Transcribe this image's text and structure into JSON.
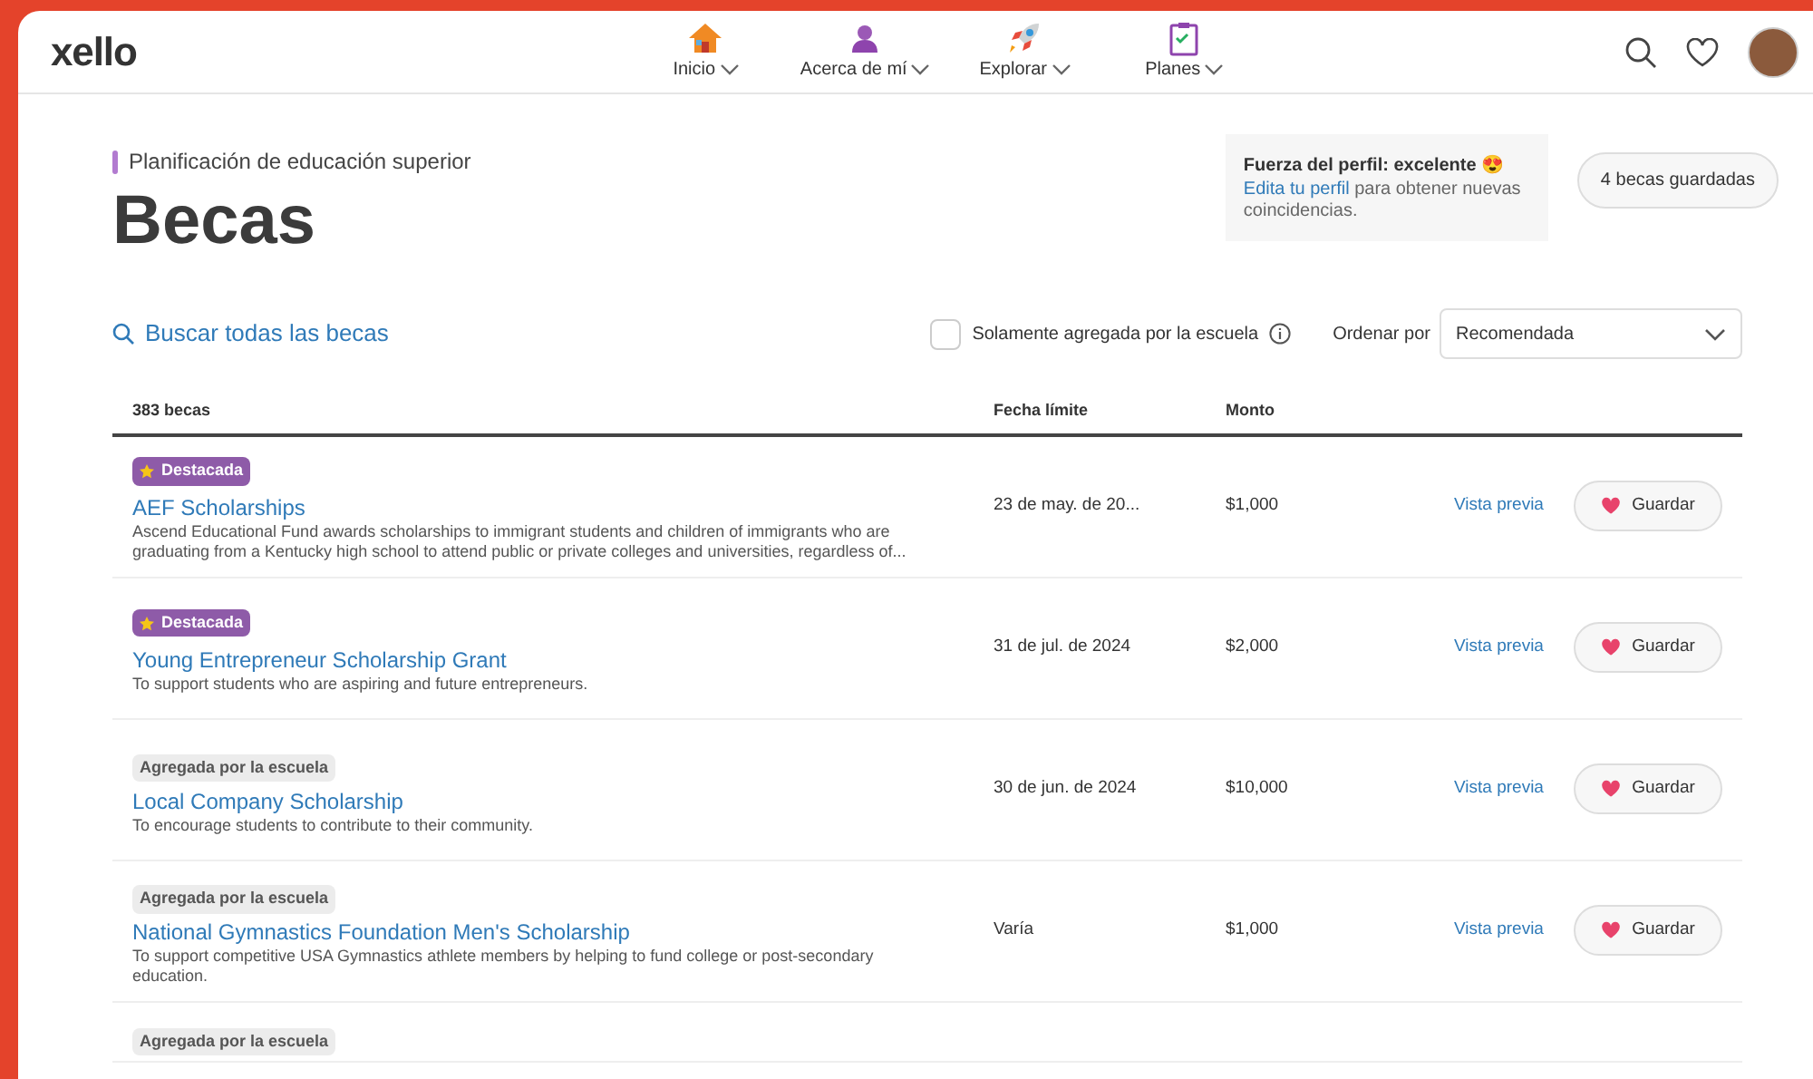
{
  "header": {
    "logo": "xello",
    "nav": [
      {
        "label": "Inicio"
      },
      {
        "label": "Acerca de mí"
      },
      {
        "label": "Explorar"
      },
      {
        "label": "Planes"
      }
    ]
  },
  "breadcrumb": "Planificación de educación superior",
  "title": "Becas",
  "profile": {
    "strength": "Fuerza del perfil: excelente",
    "emoji": "😍",
    "link": "Edita tu perfil",
    "rest": "para obtener nuevas coincidencias."
  },
  "saved_button": "4 becas guardadas",
  "search": "Buscar todas las becas",
  "school_only": {
    "label": "Solamente agregada por la escuela",
    "checked": false
  },
  "sort": {
    "label": "Ordenar por",
    "value": "Recomendada"
  },
  "table": {
    "columns": [
      "383 becas",
      "Fecha límite",
      "Monto"
    ],
    "rows": [
      {
        "badge": {
          "kind": "featured",
          "text": "Destacada"
        },
        "name": "AEF Scholarships",
        "description": "Ascend Educational Fund awards scholarships to immigrant students and children of immigrants who are graduating from a Kentucky high school to attend public or private colleges and universities, regardless of...",
        "deadline": "23 de may. de 20...",
        "amount": "$1,000",
        "preview": "Vista previa",
        "save": "Guardar"
      },
      {
        "badge": {
          "kind": "featured",
          "text": "Destacada"
        },
        "name": "Young Entrepreneur Scholarship Grant",
        "description": "To support students who are aspiring and future entrepreneurs.",
        "deadline": "31 de jul. de 2024",
        "amount": "$2,000",
        "preview": "Vista previa",
        "save": "Guardar"
      },
      {
        "badge": {
          "kind": "school",
          "text": "Agregada por la escuela"
        },
        "name": "Local Company Scholarship",
        "description": "To encourage students to contribute to their community.",
        "deadline": "30 de jun. de 2024",
        "amount": "$10,000",
        "preview": "Vista previa",
        "save": "Guardar"
      },
      {
        "badge": {
          "kind": "school",
          "text": "Agregada por la escuela"
        },
        "name": "National Gymnastics Foundation Men's Scholarship",
        "description": "To support competitive USA Gymnastics athlete members by helping to fund college or post-secondary education.",
        "deadline": "Varía",
        "amount": "$1,000",
        "preview": "Vista previa",
        "save": "Guardar"
      },
      {
        "badge": {
          "kind": "school",
          "text": "Agregada por la escuela"
        }
      }
    ]
  }
}
